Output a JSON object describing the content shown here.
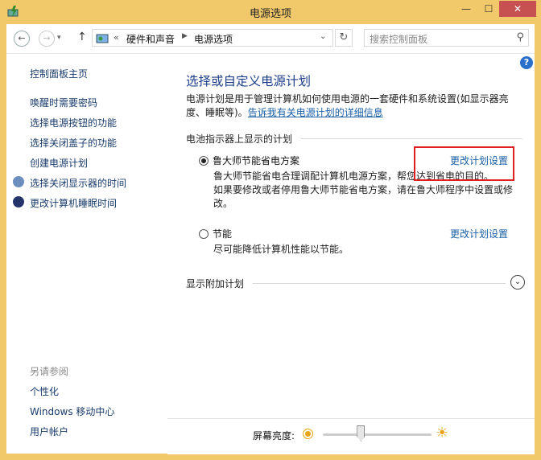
{
  "window": {
    "title": "电源选项"
  },
  "nav": {
    "breadcrumb_prefix": "«",
    "breadcrumb": [
      "硬件和声音",
      "电源选项"
    ],
    "search_placeholder": "搜索控制面板"
  },
  "sidebar": {
    "home": "控制面板主页",
    "items": [
      {
        "label": "唤醒时需要密码"
      },
      {
        "label": "选择电源按钮的功能"
      },
      {
        "label": "选择关闭盖子的功能"
      },
      {
        "label": "创建电源计划"
      },
      {
        "label": "选择关闭显示器的时间",
        "icon": "display-timer-icon"
      },
      {
        "label": "更改计算机睡眠时间",
        "icon": "sleep-moon-icon"
      }
    ],
    "see_also_heading": "另请参阅",
    "see_also": [
      {
        "label": "个性化"
      },
      {
        "label": "Windows 移动中心"
      },
      {
        "label": "用户帐户"
      }
    ]
  },
  "main": {
    "title": "选择或自定义电源计划",
    "intro_text": "电源计划是用于管理计算机如何使用电源的一套硬件和系统设置(如显示器亮度、睡眠等)。",
    "intro_link": "告诉我有关电源计划的详细信息",
    "section_battery": "电池指示器上显示的计划",
    "plans": [
      {
        "name": "鲁大师节能省电方案",
        "selected": true,
        "desc1": "鲁大师节能省电合理调配计算机电源方案，帮您达到省电的目的。",
        "desc2": "如果要修改或者停用鲁大师节能省电方案，请在鲁大师程序中设置或修改。",
        "link": "更改计划设置"
      },
      {
        "name": "节能",
        "selected": false,
        "desc1": "尽可能降低计算机性能以节能。",
        "link": "更改计划设置"
      }
    ],
    "section_more": "显示附加计划"
  },
  "bottom": {
    "brightness_label": "屏幕亮度:",
    "brightness_level": 0.35
  },
  "colors": {
    "titlebar": "#f1c96a",
    "close": "#c75050",
    "link": "#1a5fa6",
    "highlight_box": "#e02020"
  }
}
